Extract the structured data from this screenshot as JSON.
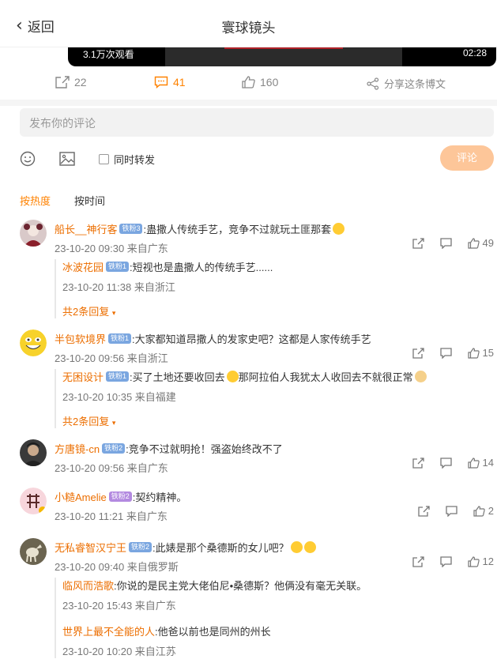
{
  "header": {
    "back_label": "返回",
    "title": "寰球镜头"
  },
  "video": {
    "views": "3.1万次观看",
    "duration": "02:28"
  },
  "actions": {
    "repost_count": "22",
    "comment_count": "41",
    "like_count": "160",
    "share_label": "分享这条博文"
  },
  "composer": {
    "placeholder": "发布你的评论",
    "repost_label": "同时转发",
    "submit_label": "评论"
  },
  "sort": {
    "hot": "按热度",
    "time": "按时间"
  },
  "comments": [
    {
      "user": "船长__神行客",
      "badge": "铁粉3",
      "text": ":蛊撒人传统手艺，竞争不过就玩土匪那套",
      "meta": "23-10-20 09:30 来自广东",
      "likes": "49",
      "replies": [
        {
          "user": "冰波花园",
          "badge": "铁粉1",
          "text": ":短视也是蛊撒人的传统手艺......",
          "meta": "23-10-20 11:38 来自浙江"
        }
      ],
      "more": "共2条回复"
    },
    {
      "user": "半包软境界",
      "badge": "铁粉1",
      "text": ":大家都知道昂撒人的发家史吧？这都是人家传统手艺",
      "meta": "23-10-20 09:56 来自浙江",
      "likes": "15",
      "replies": [
        {
          "user": "无困设计",
          "badge": "铁粉1",
          "text": ":买了土地还要收回去",
          "text2": "那阿拉伯人我犹太人收回去不就很正常",
          "meta": "23-10-20 10:35 来自福建"
        }
      ],
      "more": "共2条回复"
    },
    {
      "user": "方唐镜-cn",
      "badge": "铁粉2",
      "text": ":竞争不过就明抢！强盗始终改不了",
      "meta": "23-10-20 09:56 来自广东",
      "likes": "14"
    },
    {
      "user": "小糙Amelie",
      "badge": "铁粉2",
      "text": ":契约精神。",
      "meta": "23-10-20 11:21 来自广东",
      "likes": "2"
    },
    {
      "user": "无私睿智汉宁王",
      "badge": "铁粉2",
      "text": ":此婊是那个桑德斯的女儿吧？",
      "meta": "23-10-20 09:40 来自俄罗斯",
      "likes": "12",
      "replies": [
        {
          "user": "临风而浩歌",
          "text": ":你说的是民主党大佬伯尼•桑德斯？他俩没有毫无关联。",
          "meta": "23-10-20 15:43 来自广东"
        },
        {
          "user": "世界上最不全能的人",
          "text": ":他爸以前也是同州的州长",
          "meta": "23-10-20 10:20 来自江苏"
        }
      ]
    }
  ],
  "colors": {
    "accent": "#ff8200",
    "username": "#ec6e00",
    "submit_disabled": "#fdc699"
  },
  "icons": [
    "chevron-left-icon",
    "repost-icon",
    "comment-icon",
    "like-icon",
    "share-icon",
    "emoji-icon",
    "image-icon"
  ]
}
